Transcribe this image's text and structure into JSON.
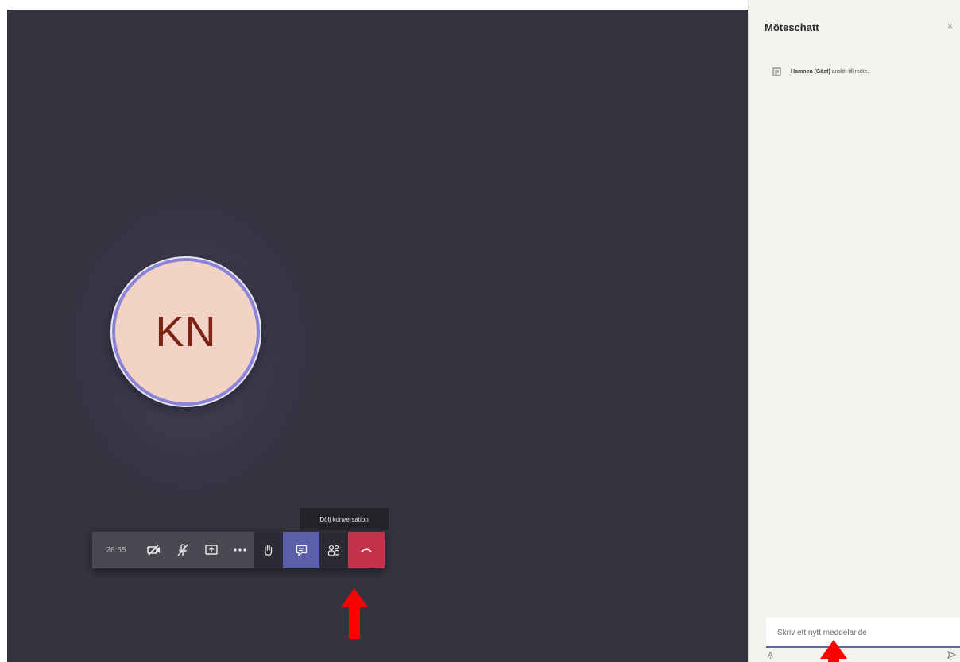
{
  "meeting": {
    "participant_initials": "KN",
    "timer": "26:55",
    "tooltip": "Dölj konversation"
  },
  "toolbar": {
    "buttons": [
      {
        "name": "camera-off-icon"
      },
      {
        "name": "mic-off-icon"
      },
      {
        "name": "share-screen-icon"
      },
      {
        "name": "more-options-icon"
      },
      {
        "name": "raise-hand-icon"
      },
      {
        "name": "chat-icon",
        "active": true
      },
      {
        "name": "participants-icon"
      },
      {
        "name": "hang-up-icon"
      }
    ]
  },
  "chat": {
    "title": "Möteschatt",
    "close_label": "×",
    "event": {
      "name": "Hamnen (Gäst)",
      "action": "anslöt till möte."
    },
    "compose_placeholder": "Skriv ett nytt meddelande",
    "format_label": "A̧"
  },
  "colors": {
    "stage": "#35333f",
    "accent": "#6264a7",
    "end_call": "#c4314b",
    "avatar_bg": "#f2d3c6",
    "avatar_text": "#7c2414",
    "annotation_arrow": "#ff0000"
  }
}
